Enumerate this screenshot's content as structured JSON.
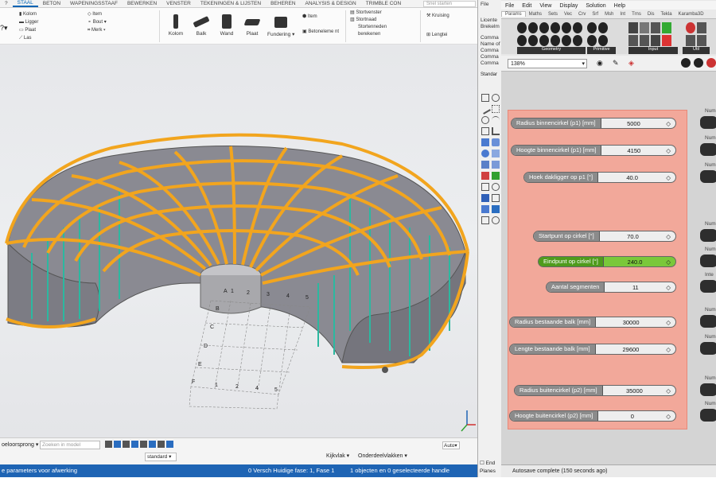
{
  "tekla": {
    "tabs": [
      "?",
      "STAAL",
      "BETON",
      "WAPENINGSSTAAF",
      "BEWERKEN",
      "VENSTER",
      "TEKENINGEN & LIJSTEN",
      "BEHEREN",
      "ANALYSIS & DESIGN",
      "TRIMBLE CON"
    ],
    "active_tab": "STAAL",
    "search_placeholder": "Snel starten",
    "ribbon": {
      "small_col1": [
        "Kolom",
        "Ligger",
        "Plaat",
        "Las"
      ],
      "small_col2": [
        "Item",
        "Bout",
        "Merk"
      ],
      "big": [
        "Kolom",
        "Balk",
        "Wand",
        "Plaat",
        "Fundering"
      ],
      "item": "Item",
      "betonelement": "Betoneleme nt",
      "storten": [
        "Stortvenster",
        "Stortnaad",
        "Stortenneden berekenen"
      ],
      "kruising": "Kruising",
      "lengte": "Lengtei"
    },
    "grid_letters": [
      "B",
      "C",
      "D",
      "E",
      "F"
    ],
    "grid_numbers": [
      "1",
      "2",
      "3",
      "4",
      "5"
    ],
    "grid_letter_a": "A",
    "bottom": {
      "origin_label": "oeloorsprong",
      "search_model_placeholder": "Zoeken in model",
      "standard": "standard",
      "kijkvlak": "Kijkvlak",
      "onderdeelvlakken": "Onderdeelvlakken",
      "auto": "Auto"
    },
    "status": {
      "left": "e parameters voor afwerking",
      "phase": "0  Versch  Huidige fase: 1, Fase 1",
      "selection": "1 objecten en 0 geselecteerde handle"
    }
  },
  "rhino": {
    "lines": [
      "File",
      "Licente",
      "Brekelm",
      "Comma",
      "Name of",
      "Comma",
      "Comma",
      "Comma"
    ],
    "end": "End",
    "planes": "Planes"
  },
  "grasshopper": {
    "title": "5142-voorzieningengebo",
    "menu": [
      "File",
      "Edit",
      "View",
      "Display",
      "Solution",
      "Help"
    ],
    "tabs": [
      "Params",
      "Maths",
      "Sets",
      "Vec",
      "Crv",
      "Srf",
      "Msh",
      "Int",
      "Trns",
      "Dis",
      "Tekla",
      "Karamba3D"
    ],
    "active_tab": "Params",
    "toolbar_groups": [
      "Geometry",
      "Primitive",
      "Input",
      "Util"
    ],
    "zoom": "138%",
    "standard": "Standar",
    "sliders": [
      {
        "label": "Radius binnencirkel (p1) [mm]",
        "value": "5000",
        "out": "Num"
      },
      {
        "label": "Hoogte binnencirkel (p1) [mm]",
        "value": "4150",
        "out": "Num"
      },
      {
        "label": "Hoek dakligger op p1 [°]",
        "value": "40.0",
        "out": "Num"
      },
      {
        "label": "Startpunt op cirkel [°]",
        "value": "70.0",
        "out": "Num"
      },
      {
        "label": "Eindpunt op cirkel [°]",
        "value": "240.0",
        "out": "Num",
        "selected": true
      },
      {
        "label": "Aantal segmenten",
        "value": "11",
        "out": "Inte"
      },
      {
        "label": "Radius bestaande balk [mm]",
        "value": "30000",
        "out": "Num"
      },
      {
        "label": "Lengte bestaande balk [mm]",
        "value": "29600",
        "out": "Num"
      },
      {
        "label": "Radius buitencirkel (p2) [mm]",
        "value": "35000",
        "out": "Num"
      },
      {
        "label": "Hoogte buitencirkel (p2) [mm]",
        "value": "0",
        "out": "Num"
      }
    ],
    "status": "Autosave complete (150 seconds ago)"
  },
  "colors": {
    "tekla_blue": "#1e64b4",
    "beam_orange": "#f2a51e",
    "slab_gray": "#8a8a92",
    "column_teal": "#2cb8a0",
    "group_salmon": "#f2a89a",
    "slider_selected": "#7ac83a"
  }
}
